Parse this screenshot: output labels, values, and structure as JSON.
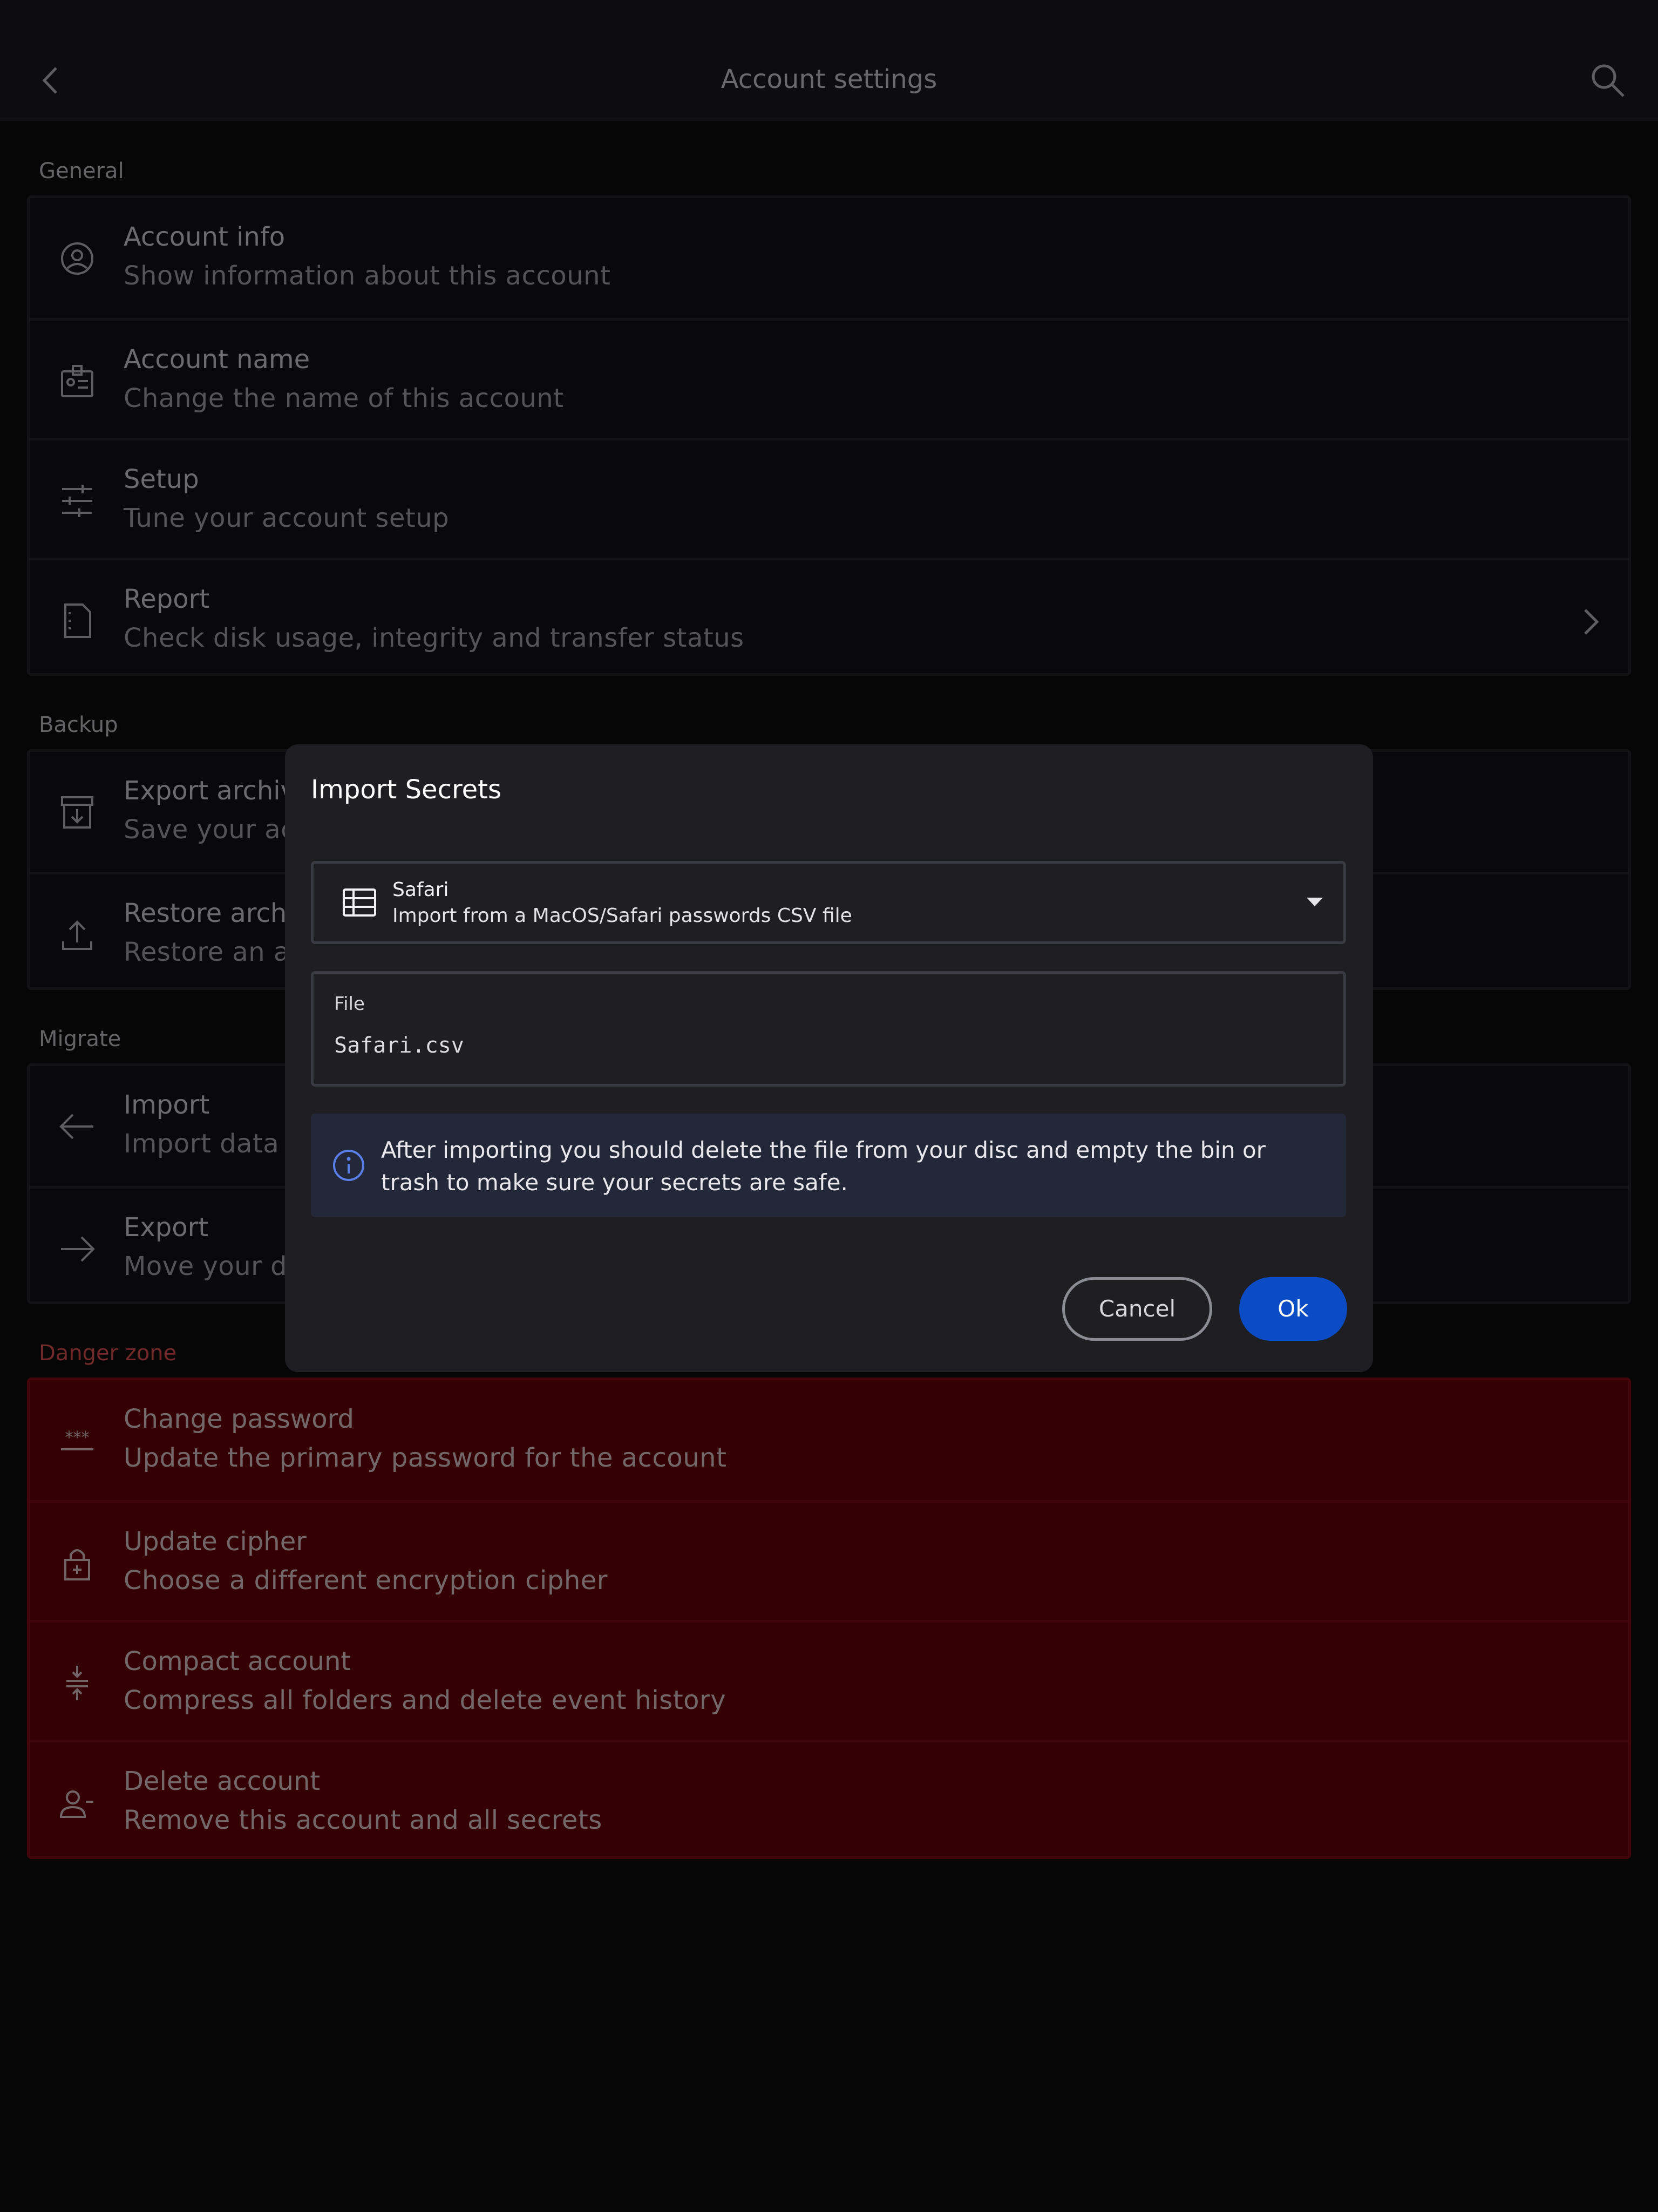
{
  "header": {
    "title": "Account settings"
  },
  "sections": {
    "general": {
      "label": "General",
      "items": [
        {
          "title": "Account info",
          "subtitle": "Show information about this account",
          "icon": "account-circle-icon"
        },
        {
          "title": "Account name",
          "subtitle": "Change the name of this account",
          "icon": "id-badge-icon"
        },
        {
          "title": "Setup",
          "subtitle": "Tune your account setup",
          "icon": "tune-icon"
        },
        {
          "title": "Report",
          "subtitle": "Check disk usage, integrity and transfer status",
          "icon": "report-file-icon"
        }
      ]
    },
    "backup": {
      "label": "Backup",
      "items": [
        {
          "title": "Export archive",
          "subtitle": "Save your account",
          "icon": "archive-download-icon"
        },
        {
          "title": "Restore archive",
          "subtitle": "Restore an account",
          "icon": "upload-icon"
        }
      ]
    },
    "migrate": {
      "label": "Migrate",
      "items": [
        {
          "title": "Import",
          "subtitle": "Import data from",
          "icon": "arrow-left-icon"
        },
        {
          "title": "Export",
          "subtitle": "Move your data",
          "icon": "arrow-right-icon"
        }
      ]
    },
    "danger": {
      "label": "Danger zone",
      "items": [
        {
          "title": "Change password",
          "subtitle": "Update the primary password for the account",
          "icon": "password-icon"
        },
        {
          "title": "Update cipher",
          "subtitle": "Choose a different encryption cipher",
          "icon": "lock-plus-icon"
        },
        {
          "title": "Compact account",
          "subtitle": "Compress all folders and delete event history",
          "icon": "compress-icon"
        },
        {
          "title": "Delete account",
          "subtitle": "Remove this account and all secrets",
          "icon": "person-remove-icon"
        }
      ]
    }
  },
  "dialog": {
    "title": "Import Secrets",
    "source": {
      "name": "Safari",
      "description": "Import from a MacOS/Safari passwords CSV file"
    },
    "file": {
      "label": "File",
      "value": "Safari.csv"
    },
    "info": "After importing you should delete the file from your disc and empty the bin or trash to make sure your secrets are safe.",
    "cancel_label": "Cancel",
    "ok_label": "Ok"
  },
  "colors": {
    "danger_background": "#6a0009",
    "danger_label": "#e35252",
    "primary_button": "#0b4bc4",
    "info_background": "#222838"
  }
}
